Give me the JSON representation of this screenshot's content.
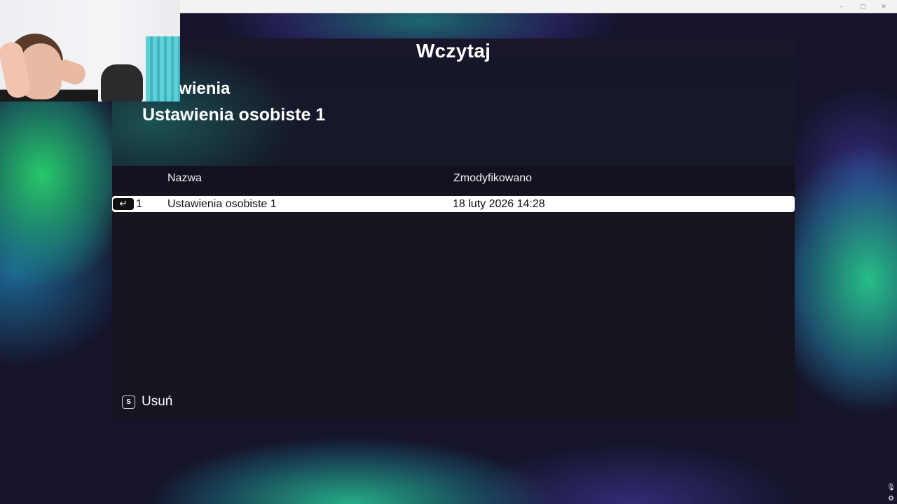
{
  "window": {
    "controls": {
      "minimize": "–",
      "maximize": "□",
      "close": "✕"
    }
  },
  "dialog": {
    "title": "Wczytaj",
    "section_label": "Ustawienia",
    "selected_name": "Ustawienia osobiste 1",
    "columns": {
      "name": "Nazwa",
      "modified": "Zmodyfikowano"
    },
    "rows": [
      {
        "index": "1",
        "name": "Ustawienia osobiste 1",
        "modified": "18 luty 2026 14:28",
        "selected": true
      }
    ],
    "enter_key_glyph": "↵",
    "footer": {
      "key": "S",
      "label": "Usuń"
    }
  },
  "tray": {
    "mic_icon": "🎙",
    "settings_icon": "⚙"
  },
  "colors": {
    "panel_bg": "#15141f",
    "selected_row_bg": "#ffffff",
    "accent_green": "#28d26e"
  }
}
